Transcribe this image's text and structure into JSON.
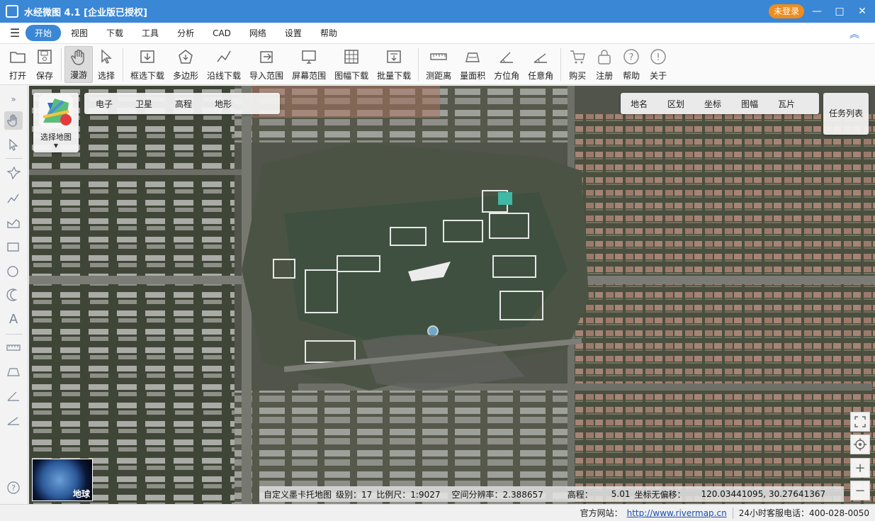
{
  "window": {
    "title": "水经微图 4.1 [企业版已授权]",
    "login_label": "未登录",
    "minimize": "—",
    "maximize": "□",
    "close": "✕"
  },
  "menu": {
    "items": [
      "开始",
      "视图",
      "下载",
      "工具",
      "分析",
      "CAD",
      "网络",
      "设置",
      "帮助"
    ],
    "active_index": 0
  },
  "toolbar": {
    "open": "打开",
    "save": "保存",
    "pan": "漫游",
    "select": "选择",
    "box_download": "框选下载",
    "polygon": "多边形",
    "line_download": "沿线下载",
    "import_range": "导入范围",
    "screen_range": "屏幕范围",
    "sheet_download": "图幅下载",
    "batch_download": "批量下载",
    "measure_distance": "测距离",
    "measure_area": "量面积",
    "azimuth": "方位角",
    "any_angle": "任意角",
    "buy": "购买",
    "register": "注册",
    "help": "帮助",
    "about": "关于"
  },
  "map": {
    "select_map_label": "选择地图",
    "map_types": [
      "电子",
      "卫星",
      "高程",
      "地形"
    ],
    "overlays": [
      "地名",
      "区划",
      "坐标",
      "图幅",
      "瓦片"
    ],
    "task_list": "任务列表",
    "globe_label": "地球",
    "zoom_in": "+",
    "zoom_out": "−",
    "status": {
      "map_name": "自定义墨卡托地图",
      "level": "级别：17",
      "scale": "比例尺：1:9027",
      "resolution": "空间分辨率：2.388657",
      "elevation_label": "高程：",
      "elevation_value": "5.01",
      "coord_label": "坐标无偏移：",
      "coord_value": "120.03441095, 30.27641367"
    }
  },
  "statusbar": {
    "site_label": "官方网站：",
    "site_url": "http://www.rivermap.cn",
    "phone_label": "24小时客服电话：",
    "phone": "400-028-0050"
  },
  "colors": {
    "title_bar": "#3a87d6",
    "login_badge": "#f08c1c",
    "menu_active": "#3a87d6",
    "icon_gray": "#7a8594"
  }
}
